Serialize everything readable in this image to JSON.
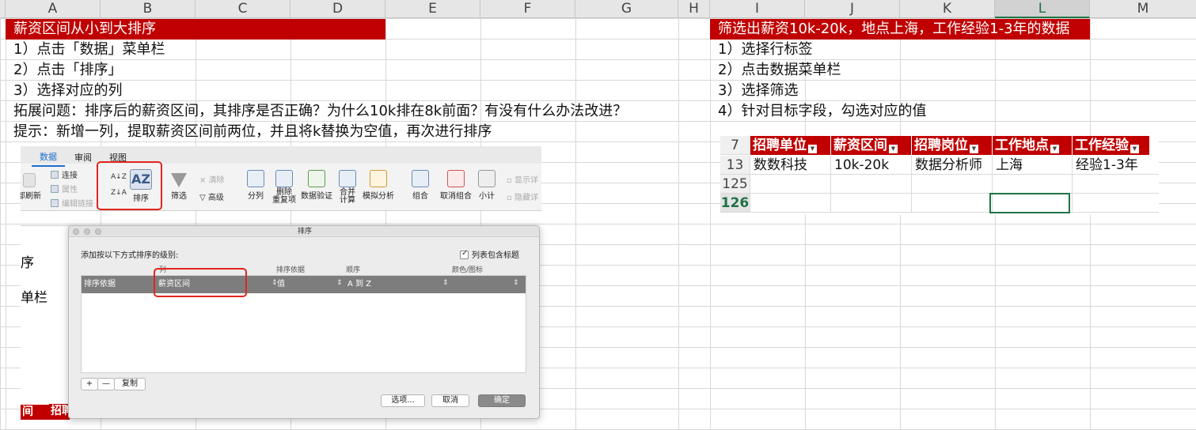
{
  "columns": [
    "A",
    "B",
    "C",
    "D",
    "E",
    "F",
    "G",
    "H",
    "I",
    "J",
    "K",
    "L",
    "M"
  ],
  "selected_column": "L",
  "left": {
    "title": "薪资区间从小到大排序",
    "steps": [
      "1）点击「数据」菜单栏",
      "2）点击「排序」",
      "3）选择对应的列"
    ],
    "question": "拓展问题：排序后的薪资区间，其排序是否正确？为什么10k排在8k前面？有没有什么办法改进？",
    "hint": "提示：新增一列，提取薪资区间前两位，并且将k替换为空值，再次进行排序",
    "behind_texts": [
      "序",
      "单栏",
      "间",
      "招聘"
    ]
  },
  "right": {
    "title": "筛选出薪资10k-20k，地点上海，工作经验1-3年的数据",
    "steps": [
      "1）选择行标签",
      "2）点击数据菜单栏",
      "3）选择筛选",
      "4）针对目标字段，勾选对应的值"
    ]
  },
  "ribbon": {
    "tabs": [
      "数据",
      "审阅",
      "视图"
    ],
    "refresh_label": "部刷新",
    "conn_items": [
      "连接",
      "属性",
      "编辑链接"
    ],
    "sort_label": "排序",
    "filter_label": "筛选",
    "clear_label": "清除",
    "advanced_label": "高级",
    "buttons": [
      {
        "id": "split",
        "label": "分列"
      },
      {
        "id": "remove-dup",
        "label": "删除\n重复项"
      },
      {
        "id": "validation",
        "label": "数据验证"
      },
      {
        "id": "merge",
        "label": "合并\n计算"
      },
      {
        "id": "whatif",
        "label": "模拟分析"
      },
      {
        "id": "group",
        "label": "组合"
      },
      {
        "id": "ungroup",
        "label": "取消组合"
      },
      {
        "id": "subtotal",
        "label": "小计"
      }
    ],
    "show_detail": "显示详",
    "hide_detail": "隐藏详"
  },
  "dialog": {
    "title": "排序",
    "instruction": "添加按以下方式排序的级别:",
    "has_header_label": "列表包含标题",
    "headers": {
      "col": "列",
      "by": "排序依据",
      "order": "顺序",
      "color": "颜色/图标"
    },
    "row": {
      "label": "排序依据",
      "column": "薪资区间",
      "by": "值",
      "order": "A 到 Z",
      "color": ""
    },
    "add_btn": "+",
    "remove_btn": "—",
    "copy_btn": "复制",
    "options_btn": "选项...",
    "cancel_btn": "取消",
    "ok_btn": "确定"
  },
  "filter_table": {
    "header_row_num": "7",
    "headers": [
      "招聘单位",
      "薪资区间",
      "招聘岗位",
      "工作地点",
      "工作经验"
    ],
    "rows": [
      {
        "num": "13",
        "cells": [
          "数数科技",
          "10k-20k",
          "数据分析师",
          "上海",
          "经验1-3年"
        ]
      },
      {
        "num": "125",
        "cells": [
          "",
          "",
          "",
          "",
          ""
        ]
      },
      {
        "num": "126",
        "cells": [
          "",
          "",
          "",
          "",
          ""
        ]
      }
    ],
    "selected_row_num": "126"
  },
  "colors": {
    "accent_red": "#c00000",
    "excel_green": "#217346",
    "highlight": "#e0261e"
  }
}
